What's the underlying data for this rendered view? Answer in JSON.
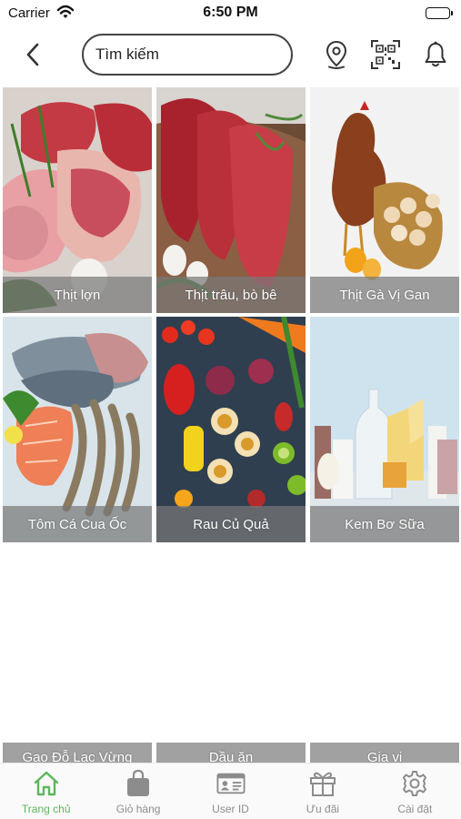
{
  "status_bar": {
    "carrier": "Carrier",
    "time": "6:50 PM"
  },
  "nav": {
    "search_placeholder": "Tìm kiếm",
    "icons": [
      "back-icon",
      "location-pin-icon",
      "qr-code-icon",
      "bell-icon"
    ]
  },
  "categories": [
    {
      "label": "Thịt lợn",
      "image": "pork-meat"
    },
    {
      "label": "Thịt trâu, bò bê",
      "image": "beef"
    },
    {
      "label": "Thịt Gà Vị Gan",
      "image": "chicken-eggs"
    },
    {
      "label": "Tôm Cá Cua Ốc",
      "image": "seafood"
    },
    {
      "label": "Rau Củ Quả",
      "image": "vegetables-fruits"
    },
    {
      "label": "Kem  Bơ Sữa",
      "image": "dairy"
    },
    {
      "label": "Gạo Đỗ Lạc Vừng",
      "image": ""
    },
    {
      "label": "Dầu ăn",
      "image": ""
    },
    {
      "label": "Gia vị",
      "image": ""
    }
  ],
  "tabs": [
    {
      "label": "Trang chủ",
      "icon": "home-icon",
      "active": true
    },
    {
      "label": "Giỏ hàng",
      "icon": "shopping-bag-icon",
      "active": false
    },
    {
      "label": "User ID",
      "icon": "id-card-icon",
      "active": false
    },
    {
      "label": "Ưu đãi",
      "icon": "gift-icon",
      "active": false
    },
    {
      "label": "Cài đặt",
      "icon": "gear-icon",
      "active": false
    }
  ],
  "colors": {
    "accent": "#5cb85c",
    "tab_inactive": "#8c8c8c",
    "caption_bg": "#787878"
  }
}
